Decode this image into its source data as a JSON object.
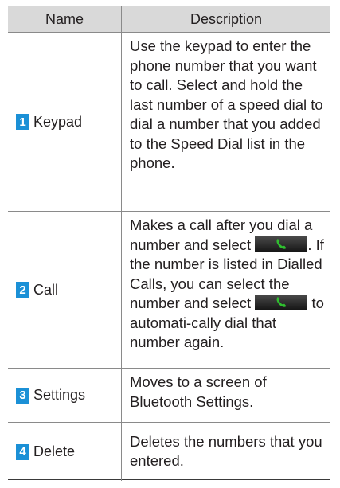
{
  "table": {
    "headers": {
      "name": "Name",
      "description": "Description"
    },
    "rows": [
      {
        "number": "1",
        "name": "Keypad",
        "description": "Use the keypad to enter the phone number that you want to call. Select and hold the last number of a speed dial to dial a number that you added to the Speed Dial list in the phone."
      },
      {
        "number": "2",
        "name": "Call",
        "description_part1": "Makes a call after you dial a number and select",
        "description_part2": ". If the number is listed in Dialled Calls, you can select the number and select",
        "description_part3": "to automati-cally dial that number again."
      },
      {
        "number": "3",
        "name": "Settings",
        "description": "Moves to a screen of Bluetooth Settings."
      },
      {
        "number": "4",
        "name": "Delete",
        "description": "Deletes the numbers that you entered."
      }
    ]
  },
  "icons": {
    "call_button": "green-phone-handset-icon"
  },
  "colors": {
    "badge": "#1b90d6",
    "header_bg": "#d9d9d9",
    "call_icon": "#2fbf2f"
  }
}
